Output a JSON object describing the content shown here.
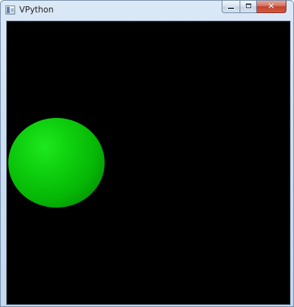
{
  "window": {
    "title": "VPython",
    "icons": {
      "app": "app-window-icon",
      "minimize": "minimize-icon",
      "maximize": "maximize-icon",
      "close": "close-icon"
    },
    "colors": {
      "titlebar": "#cfe0f2",
      "close_button": "#c2412c"
    }
  },
  "scene": {
    "background_color": "#000000",
    "objects": [
      {
        "type": "sphere",
        "color": "#00cc00"
      }
    ]
  }
}
